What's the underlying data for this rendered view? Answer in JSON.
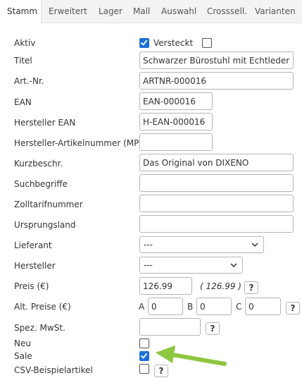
{
  "tabs": [
    {
      "label": "Stamm",
      "active": true
    },
    {
      "label": "Erweitert"
    },
    {
      "label": "Lager"
    },
    {
      "label": "Mall"
    },
    {
      "label": "Auswahl"
    },
    {
      "label": "Crosssell."
    },
    {
      "label": "Varianten"
    }
  ],
  "fields": {
    "aktiv": {
      "label": "Aktiv",
      "checked": true,
      "versteckt_label": "Versteckt",
      "versteckt_checked": false
    },
    "titel": {
      "label": "Titel",
      "value": "Schwarzer Bürostuhl mit Echtleder"
    },
    "artnr": {
      "label": "Art.-Nr.",
      "value": "ARTNR-000016"
    },
    "ean": {
      "label": "EAN",
      "value": "EAN-000016"
    },
    "hersteller_ean": {
      "label": "Hersteller EAN",
      "value": "H-EAN-000016"
    },
    "mpn": {
      "label": "Hersteller-Artikelnummer (MPN)",
      "value": ""
    },
    "kurzbeschr": {
      "label": "Kurzbeschr.",
      "value": "Das Original von DIXENO"
    },
    "suchbegriffe": {
      "label": "Suchbegriffe",
      "value": ""
    },
    "zolltarifnummer": {
      "label": "Zolltarifnummer",
      "value": ""
    },
    "ursprungsland": {
      "label": "Ursprungsland",
      "value": ""
    },
    "lieferant": {
      "label": "Lieferant",
      "value": "---"
    },
    "hersteller": {
      "label": "Hersteller",
      "value": "---"
    },
    "preis": {
      "label": "Preis (€)",
      "value": "126.99",
      "computed": "( 126.99 )"
    },
    "alt_preise": {
      "label": "Alt. Preise (€)",
      "a_label": "A",
      "a_value": "0",
      "b_label": "B",
      "b_value": "0",
      "c_label": "C",
      "c_value": "0"
    },
    "spez_mwst": {
      "label": "Spez. MwSt.",
      "value": ""
    },
    "neu": {
      "label": "Neu",
      "checked": false
    },
    "sale": {
      "label": "Sale",
      "checked": true
    },
    "csv": {
      "label": "CSV-Beispielartikel",
      "checked": false
    }
  },
  "help_label": "?",
  "colors": {
    "accent": "#1e6fd9",
    "arrow": "#8dc63f"
  }
}
